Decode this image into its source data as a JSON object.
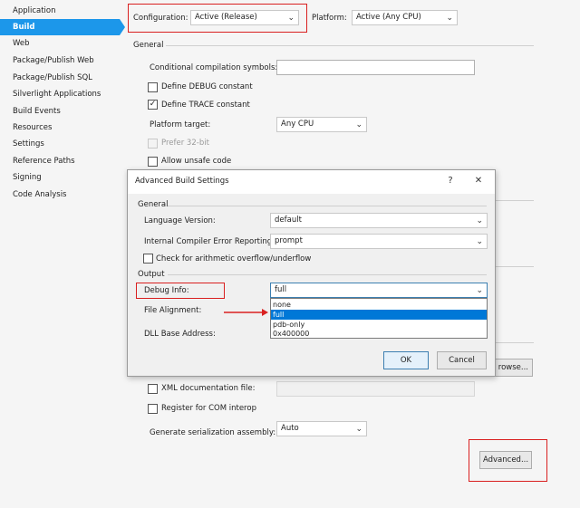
{
  "sidebar": {
    "items": [
      {
        "label": "Application"
      },
      {
        "label": "Build"
      },
      {
        "label": "Web"
      },
      {
        "label": "Package/Publish Web"
      },
      {
        "label": "Package/Publish SQL"
      },
      {
        "label": "Silverlight Applications"
      },
      {
        "label": "Build Events"
      },
      {
        "label": "Resources"
      },
      {
        "label": "Settings"
      },
      {
        "label": "Reference Paths"
      },
      {
        "label": "Signing"
      },
      {
        "label": "Code Analysis"
      }
    ],
    "active_index": 1
  },
  "header": {
    "configuration_label": "Configuration:",
    "configuration_value": "Active (Release)",
    "platform_label": "Platform:",
    "platform_value": "Active (Any CPU)"
  },
  "general": {
    "title": "General",
    "conditional_symbols_label": "Conditional compilation symbols:",
    "conditional_symbols_value": "",
    "define_debug_label": "Define DEBUG constant",
    "define_debug_checked": false,
    "define_trace_label": "Define TRACE constant",
    "define_trace_checked": true,
    "platform_target_label": "Platform target:",
    "platform_target_value": "Any CPU",
    "prefer32_label": "Prefer 32-bit",
    "unsafe_label": "Allow unsafe code"
  },
  "output": {
    "browse_label": "rowse...",
    "xml_doc_label": "XML documentation file:",
    "register_com_label": "Register for COM interop",
    "serialization_label": "Generate serialization assembly:",
    "serialization_value": "Auto",
    "advanced_label": "Advanced..."
  },
  "dialog": {
    "title": "Advanced Build Settings",
    "help_icon": "?",
    "close_icon": "✕",
    "general_title": "General",
    "language_version_label": "Language Version:",
    "language_version_value": "default",
    "ice_reporting_label": "Internal Compiler Error Reporting:",
    "ice_reporting_value": "prompt",
    "overflow_label": "Check for arithmetic overflow/underflow",
    "output_title": "Output",
    "debug_info_label": "Debug Info:",
    "debug_info_value": "full",
    "debug_options": [
      "none",
      "full",
      "pdb-only",
      "0x400000"
    ],
    "debug_selected_index": 1,
    "file_alignment_label": "File Alignment:",
    "dll_base_label": "DLL Base Address:",
    "ok_label": "OK",
    "cancel_label": "Cancel"
  },
  "colors": {
    "accent": "#1c97ea",
    "highlight": "#d92020",
    "selection": "#0078d7"
  }
}
